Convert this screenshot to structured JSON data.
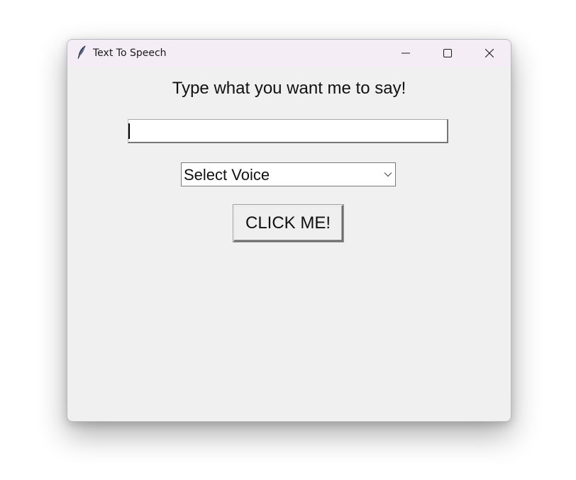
{
  "window": {
    "title": "Text To Speech",
    "app_icon": "feather-icon",
    "controls": {
      "minimize_icon": "minimize-icon",
      "maximize_icon": "maximize-icon",
      "close_icon": "close-icon"
    }
  },
  "main": {
    "heading": "Type what you want me to say!",
    "text_entry": {
      "value": "",
      "placeholder": ""
    },
    "voice_select": {
      "selected": "Select Voice",
      "arrow_icon": "chevron-down-icon"
    },
    "speak_button_label": "CLICK ME!"
  },
  "colors": {
    "titlebar": "#f4edf6",
    "window_background": "#f0f0f0",
    "entry_background": "#ffffff"
  }
}
